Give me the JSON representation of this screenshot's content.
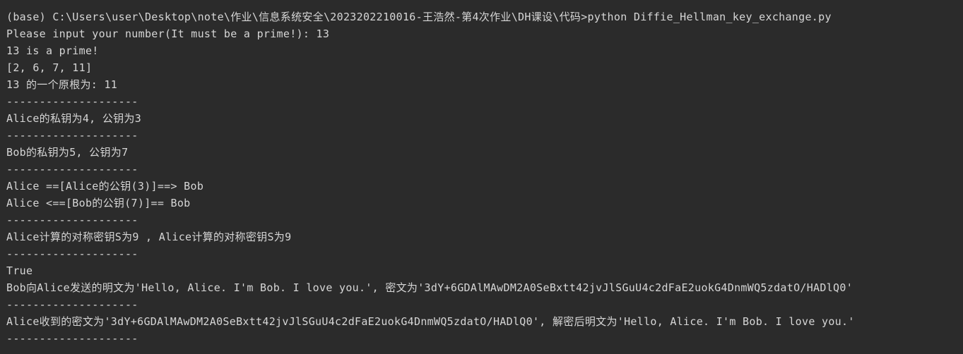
{
  "terminal": {
    "lines": [
      "(base) C:\\Users\\user\\Desktop\\note\\作业\\信息系统安全\\2023202210016-王浩然-第4次作业\\DH课设\\代码>python Diffie_Hellman_key_exchange.py",
      "Please input your number(It must be a prime!): 13",
      "13 is a prime!",
      "[2, 6, 7, 11]",
      "13 的一个原根为: 11",
      "--------------------",
      "Alice的私钥为4, 公钥为3",
      "--------------------",
      "Bob的私钥为5, 公钥为7",
      "--------------------",
      "Alice ==[Alice的公钥(3)]==> Bob",
      "Alice <==[Bob的公钥(7)]== Bob",
      "--------------------",
      "Alice计算的对称密钥S为9 , Alice计算的对称密钥S为9",
      "--------------------",
      "True",
      "Bob向Alice发送的明文为'Hello, Alice. I'm Bob. I love you.', 密文为'3dY+6GDAlMAwDM2A0SeBxtt42jvJlSGuU4c2dFaE2uokG4DnmWQ5zdatO/HADlQ0'",
      "--------------------",
      "Alice收到的密文为'3dY+6GDAlMAwDM2A0SeBxtt42jvJlSGuU4c2dFaE2uokG4DnmWQ5zdatO/HADlQ0', 解密后明文为'Hello, Alice. I'm Bob. I love you.'",
      "--------------------"
    ]
  }
}
